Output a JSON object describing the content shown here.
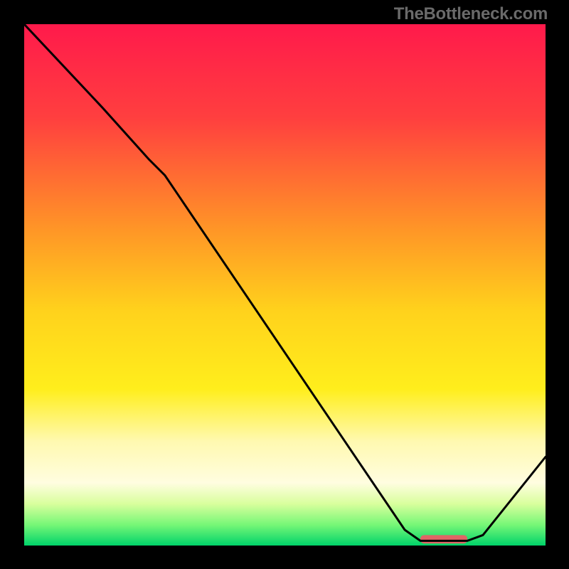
{
  "watermark": "TheBottleneck.com",
  "chart_data": {
    "type": "line",
    "title": "",
    "xlabel": "",
    "ylabel": "",
    "xlim": [
      0,
      100
    ],
    "ylim": [
      0,
      100
    ],
    "gradient_stops": [
      {
        "offset": 0,
        "color": "#ff1a4b"
      },
      {
        "offset": 18,
        "color": "#ff3f3f"
      },
      {
        "offset": 40,
        "color": "#ff9826"
      },
      {
        "offset": 55,
        "color": "#ffd21c"
      },
      {
        "offset": 70,
        "color": "#ffee1c"
      },
      {
        "offset": 80,
        "color": "#fff9b0"
      },
      {
        "offset": 88,
        "color": "#fffde0"
      },
      {
        "offset": 92,
        "color": "#d9ff9d"
      },
      {
        "offset": 96,
        "color": "#77f777"
      },
      {
        "offset": 100,
        "color": "#00d36a"
      }
    ],
    "series": [
      {
        "name": "curve",
        "type": "line",
        "color": "#000000",
        "points": [
          {
            "x": 0,
            "y": 100
          },
          {
            "x": 15,
            "y": 84
          },
          {
            "x": 24,
            "y": 74
          },
          {
            "x": 27,
            "y": 71
          },
          {
            "x": 73,
            "y": 3
          },
          {
            "x": 76,
            "y": 0.9
          },
          {
            "x": 85,
            "y": 0.9
          },
          {
            "x": 88,
            "y": 2
          },
          {
            "x": 100,
            "y": 17
          }
        ]
      },
      {
        "name": "optimum-marker",
        "type": "bar",
        "color": "#e06666",
        "x_start": 76,
        "x_end": 85,
        "y": 1.2,
        "thickness": 1.6
      }
    ]
  }
}
